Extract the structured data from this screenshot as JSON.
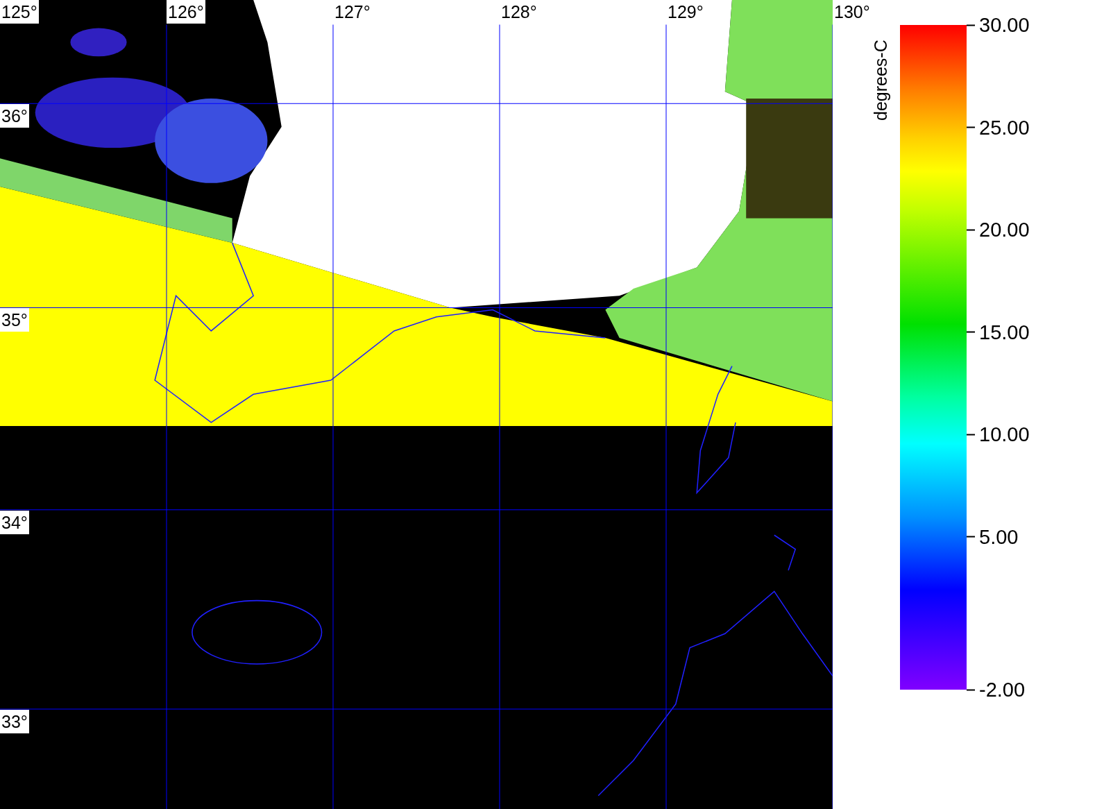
{
  "map": {
    "longitude_labels": [
      "125°",
      "126°",
      "127°",
      "128°",
      "129°",
      "130°"
    ],
    "latitude_labels": [
      "36°",
      "35°",
      "34°",
      "33°"
    ]
  },
  "colorbar": {
    "unit": "degrees-C",
    "ticks": [
      "30.00",
      "25.00",
      "20.00",
      "15.00",
      "10.00",
      "5.00",
      "-2.00"
    ]
  }
}
